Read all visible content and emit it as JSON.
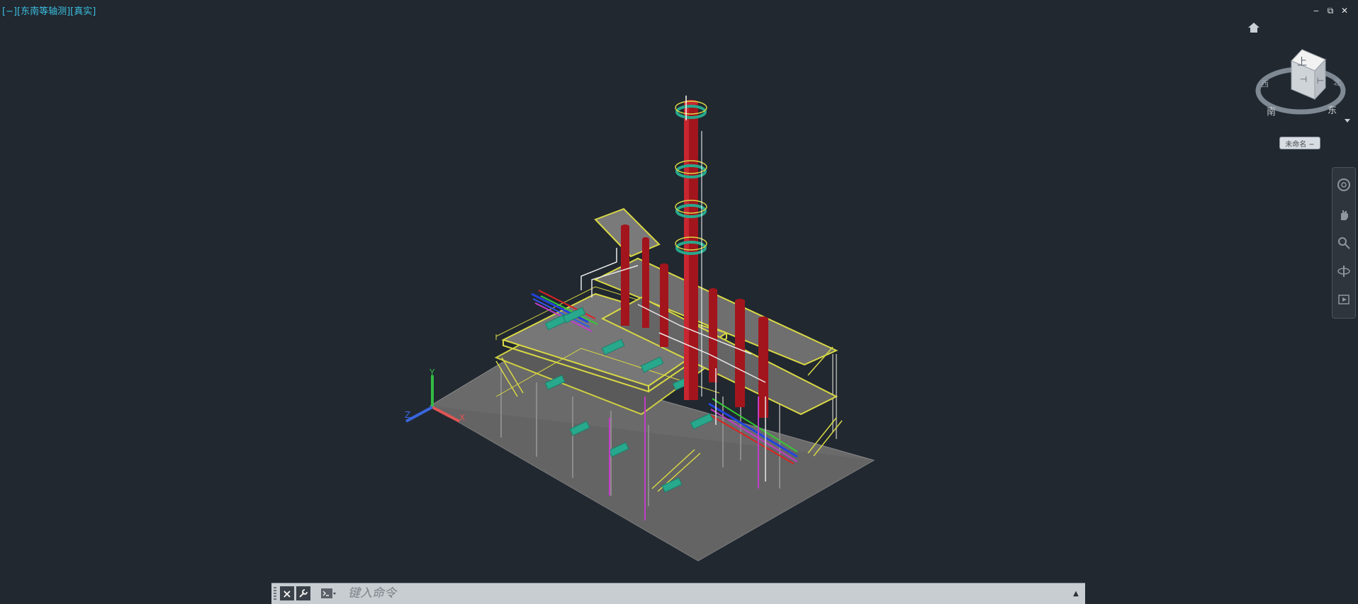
{
  "viewport": {
    "label": "[−][东南等轴测][真实]",
    "background": "#212830",
    "label_color": "#3bbfe0"
  },
  "window_controls": {
    "minimize": "‒",
    "restore": "⧉",
    "close": "✕"
  },
  "viewcube": {
    "top_face": "上",
    "compass": {
      "north": "北",
      "south": "南",
      "east": "东",
      "west": "西"
    },
    "view_name": "未命名 −"
  },
  "ucs": {
    "x": "X",
    "y": "Y",
    "z": "Z"
  },
  "navbar": {
    "tools": [
      "steering-wheel-icon",
      "pan-hand-icon",
      "zoom-icon",
      "orbit-icon",
      "showmotion-icon"
    ]
  },
  "command_line": {
    "placeholder": "键入命令",
    "close_label": "×",
    "history_arrow": "▲"
  },
  "colors": {
    "ground": "#6e6e6e",
    "column_red": "#a3151c",
    "platform_yellow": "#d8d844",
    "equipment_teal": "#28a88c",
    "pipe_blue": "#2244dd",
    "pipe_magenta": "#c23cc8"
  }
}
